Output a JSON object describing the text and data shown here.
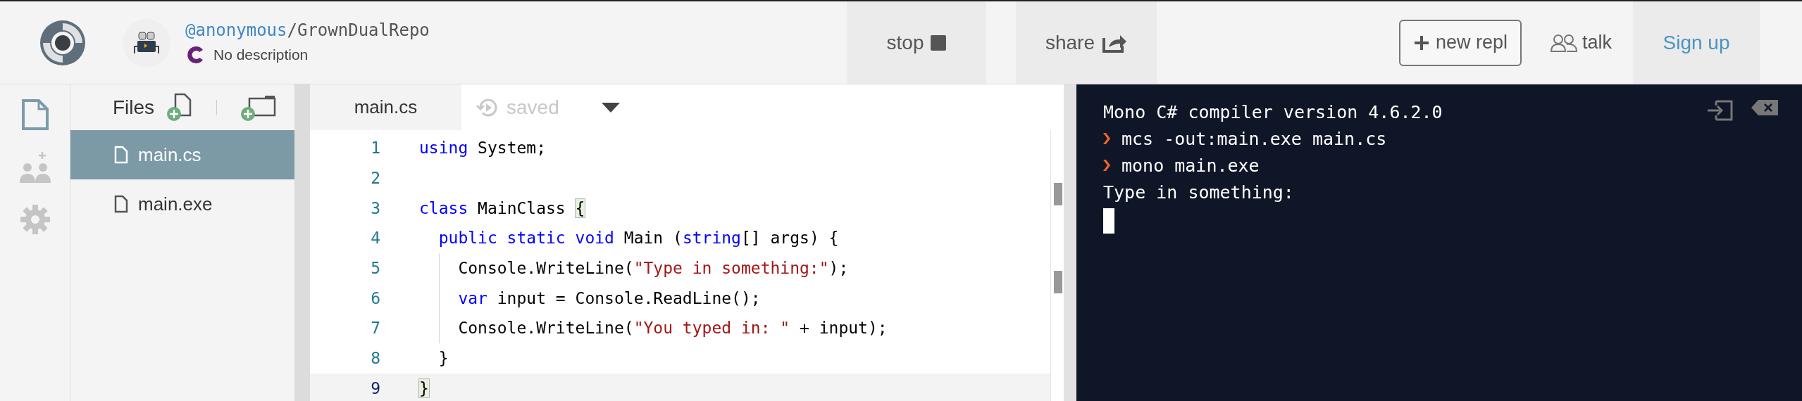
{
  "header": {
    "owner": "@anonymous",
    "separator": "/",
    "repl_name": "GrownDualRepo",
    "description": "No description",
    "actions": [
      {
        "kind": "stop",
        "label": "stop"
      },
      {
        "kind": "share",
        "label": "share"
      }
    ],
    "new_repl": "new repl",
    "talk": "talk",
    "sign_up": "Sign up"
  },
  "sidebar": {
    "items": [
      {
        "kind": "files",
        "selected": true
      },
      {
        "kind": "invite",
        "selected": false
      },
      {
        "kind": "settings",
        "selected": false
      }
    ]
  },
  "files": {
    "title": "Files",
    "items": [
      {
        "name": "main.cs",
        "selected": true
      },
      {
        "name": "main.exe",
        "selected": false
      }
    ]
  },
  "editor": {
    "tab": "main.cs",
    "status": "saved",
    "lines": [
      {
        "number": "1",
        "active": false,
        "segments": [
          {
            "kind": "keyword",
            "text": "using"
          },
          {
            "kind": "plain",
            "text": " System;"
          }
        ]
      },
      {
        "number": "2",
        "active": false
      },
      {
        "number": "3",
        "active": false,
        "segments": [
          {
            "kind": "keyword",
            "text": "class"
          },
          {
            "kind": "plain",
            "text": " MainClass "
          },
          {
            "kind": "bracket",
            "text": "{"
          }
        ],
        "children": [
          {
            "number": "4",
            "active": false,
            "segments": [
              {
                "kind": "keyword",
                "text": "public static void"
              },
              {
                "kind": "plain",
                "text": " Main ("
              },
              {
                "kind": "keyword",
                "text": "string"
              },
              {
                "kind": "plain",
                "text": "[] args) {"
              }
            ],
            "children": [
              {
                "number": "5",
                "active": false,
                "segments": [
                  {
                    "kind": "plain",
                    "text": "Console.WriteLine("
                  },
                  {
                    "kind": "string",
                    "text": "\"Type in something:\""
                  },
                  {
                    "kind": "plain",
                    "text": ");"
                  }
                ]
              },
              {
                "number": "6",
                "active": false,
                "segments": [
                  {
                    "kind": "keyword",
                    "text": "var"
                  },
                  {
                    "kind": "plain",
                    "text": " input = Console.ReadLine();"
                  }
                ]
              },
              {
                "number": "7",
                "active": false,
                "segments": [
                  {
                    "kind": "plain",
                    "text": "Console.WriteLine("
                  },
                  {
                    "kind": "string",
                    "text": "\"You typed in: \""
                  },
                  {
                    "kind": "plain",
                    "text": " + input);"
                  }
                ]
              }
            ]
          },
          {
            "number": "8",
            "active": false,
            "segments": [
              {
                "kind": "plain",
                "text": "}"
              }
            ]
          }
        ]
      },
      {
        "number": "9",
        "active": true,
        "segments": [
          {
            "kind": "bracket",
            "text": "}"
          }
        ]
      }
    ]
  },
  "terminal": {
    "lines": [
      {
        "kind": "output",
        "text": "Mono C# compiler version 4.6.2.0"
      },
      {
        "kind": "command",
        "text": "mcs -out:main.exe main.cs"
      },
      {
        "kind": "command",
        "text": "mono main.exe"
      },
      {
        "kind": "output",
        "text": "Type in something:"
      }
    ]
  }
}
